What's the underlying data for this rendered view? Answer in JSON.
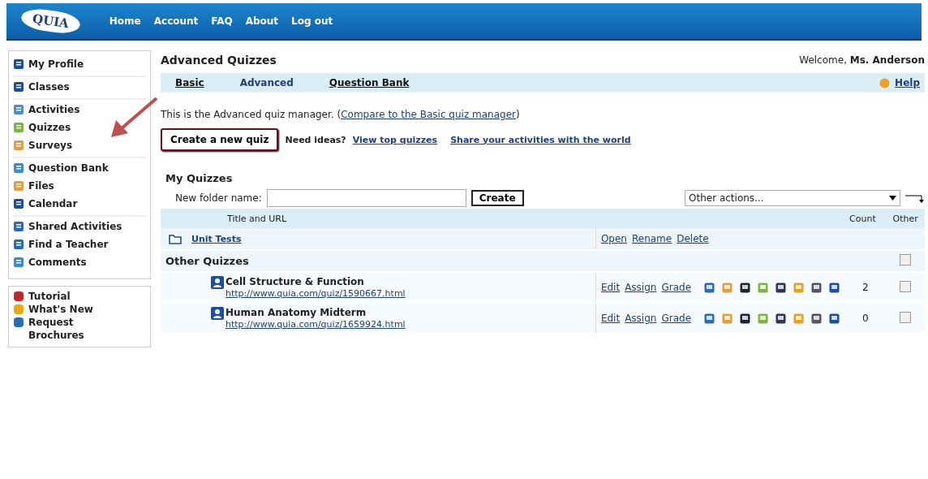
{
  "header": {
    "logo": "QUIA",
    "nav": [
      "Home",
      "Account",
      "FAQ",
      "About",
      "Log out"
    ]
  },
  "sidebar": {
    "groups": [
      [
        "My Profile"
      ],
      [
        "Classes"
      ],
      [
        "Activities",
        "Quizzes",
        "Surveys"
      ],
      [
        "Question Bank",
        "Files",
        "Calendar"
      ],
      [
        "Shared Activities",
        "Find a Teacher",
        "Comments"
      ]
    ],
    "extra": [
      "Tutorial",
      "What's New",
      "Request Brochures"
    ]
  },
  "page": {
    "title": "Advanced Quizzes",
    "welcome": "Welcome, **Ms. Anderson**",
    "tabs": [
      {
        "label": "Basic",
        "selected": false
      },
      {
        "label": "Advanced",
        "selected": true
      },
      {
        "label": "Question Bank",
        "selected": false
      }
    ],
    "help": "Help",
    "intro": "This is the Advanced quiz manager. (",
    "intro_link": "Compare to the Basic quiz manager",
    "intro_end": ")",
    "create_button": "Create a new quiz",
    "ideas": "Need ideas?",
    "ideas_link": "View top quizzes",
    "share_link": "Share your activities with the world"
  },
  "quizzes": {
    "title": "My Quizzes",
    "folder_label": "New folder name:",
    "create": "Create",
    "actions_placeholder": "Other actions...",
    "columns": [
      "Title and URL",
      "Count",
      "Other"
    ],
    "folders": [
      {
        "name": "Unit Tests",
        "actions": [
          "Open",
          "Rename",
          "Delete"
        ]
      }
    ],
    "group": {
      "name": "Other Quizzes",
      "checked": false
    },
    "rows": [
      {
        "title": "Cell Structure & Function",
        "url": "http://www.quia.com/quiz/1590667.html",
        "actions": [
          "Edit",
          "Assign",
          "Grade"
        ],
        "count": "2",
        "checked": false
      },
      {
        "title": "Human Anatomy Midterm",
        "url": "http://www.quia.com/quiz/1659924.html",
        "actions": [
          "Edit",
          "Assign",
          "Grade"
        ],
        "count": "0",
        "checked": false
      }
    ]
  }
}
